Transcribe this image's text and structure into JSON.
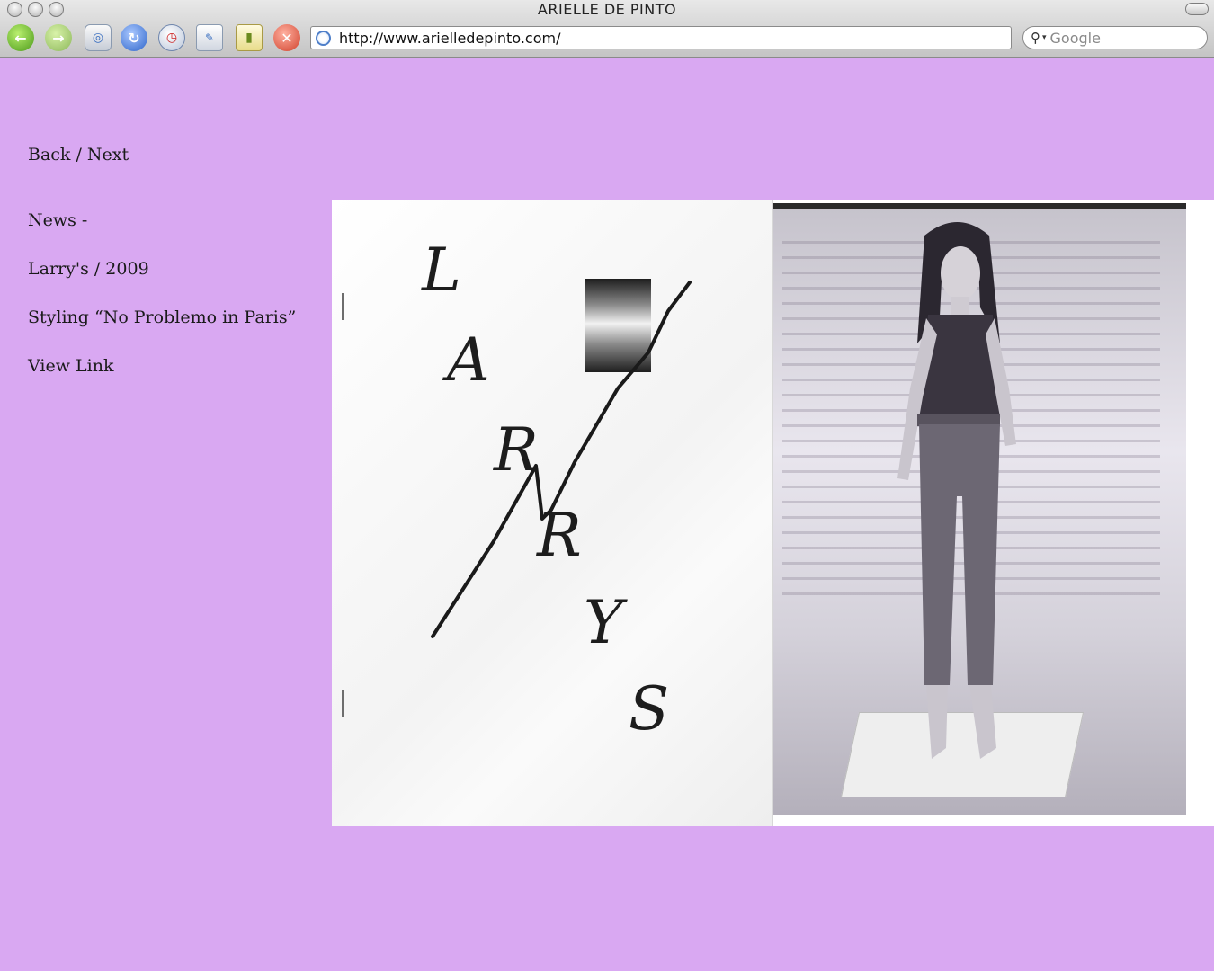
{
  "window": {
    "title": "ARIELLE DE PINTO"
  },
  "browser": {
    "url": "http://www.arielledepinto.com/",
    "search_placeholder": "Google"
  },
  "nav": {
    "back_next": "Back / Next",
    "news": "News -",
    "project": "Larry's / 2009",
    "styling": "Styling “No Problemo in Paris”",
    "view_link": "View Link"
  },
  "zine": {
    "cover_letters": [
      "L",
      "A",
      "R",
      "R",
      "Y",
      "S"
    ]
  },
  "colors": {
    "page_background": "#d9a8f2",
    "chrome": "#c4c4c4"
  }
}
